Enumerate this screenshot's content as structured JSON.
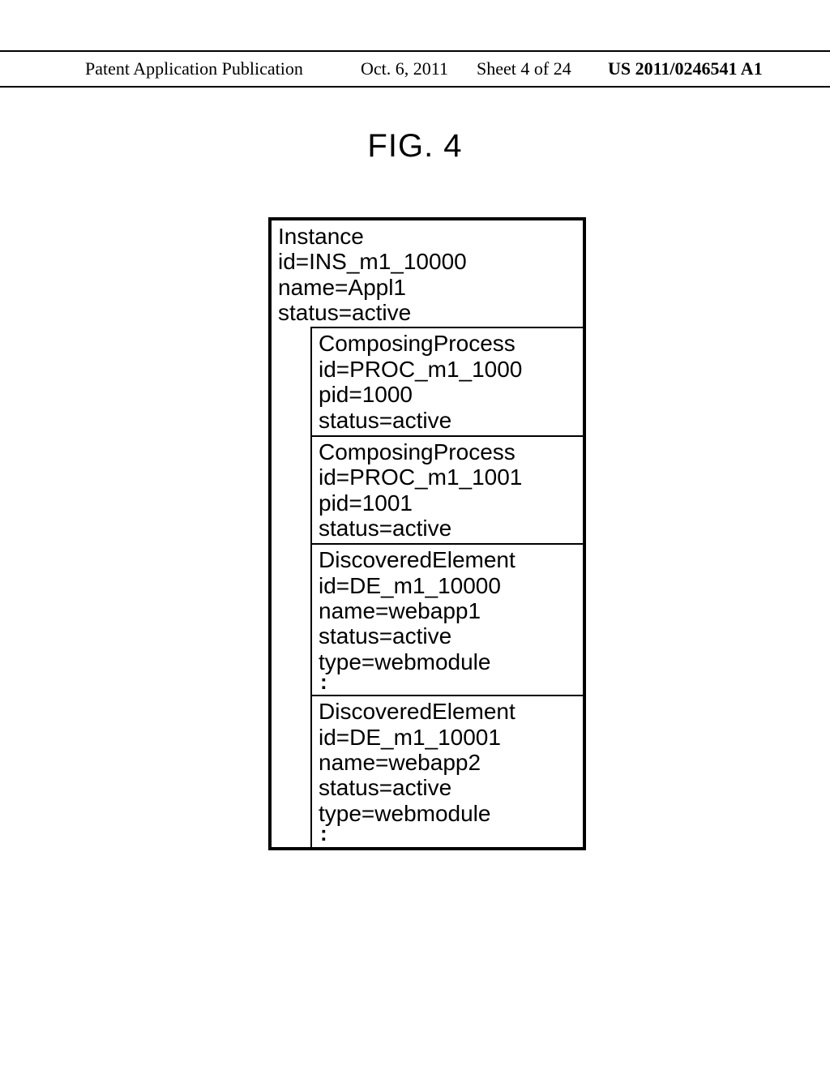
{
  "header": {
    "left": "Patent Application Publication",
    "date": "Oct. 6, 2011",
    "sheet": "Sheet 4 of 24",
    "pubnum": "US 2011/0246541 A1"
  },
  "figure_label": "FIG. 4",
  "instance": {
    "title": "Instance",
    "id_line": "id=INS_m1_10000",
    "name_line": "name=Appl1",
    "status_line": "status=active"
  },
  "blocks": [
    {
      "title": "ComposingProcess",
      "lines": [
        "id=PROC_m1_1000",
        "pid=1000",
        "status=active"
      ],
      "trailing_ellipsis": false
    },
    {
      "title": "ComposingProcess",
      "lines": [
        "id=PROC_m1_1001",
        "pid=1001",
        "status=active"
      ],
      "trailing_ellipsis": false
    },
    {
      "title": "DiscoveredElement",
      "lines": [
        "id=DE_m1_10000",
        "name=webapp1",
        "status=active",
        "type=webmodule"
      ],
      "trailing_ellipsis": true
    },
    {
      "title": "DiscoveredElement",
      "lines": [
        "id=DE_m1_10001",
        "name=webapp2",
        "status=active",
        "type=webmodule"
      ],
      "trailing_ellipsis": true
    }
  ],
  "ellipsis_glyph": ":"
}
